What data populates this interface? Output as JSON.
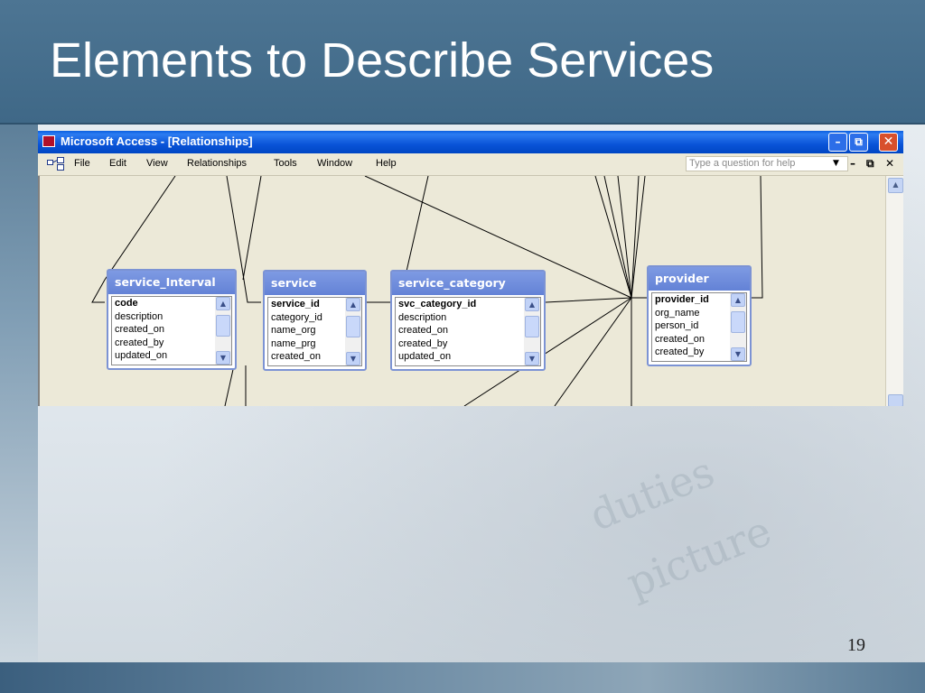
{
  "slide": {
    "title": "Elements to Describe Services",
    "page_number": "19"
  },
  "window": {
    "title": "Microsoft Access - [Relationships]",
    "minimize_glyph": "–",
    "restore_glyph": "⧉",
    "close_glyph": "✕"
  },
  "menu": {
    "items": [
      "File",
      "Edit",
      "View",
      "Relationships",
      "Tools",
      "Window",
      "Help"
    ],
    "ask_placeholder": "Type a question for help",
    "ask_dropdown_glyph": "▼",
    "mdi_minimize_glyph": "–",
    "mdi_restore_glyph": "⧉",
    "mdi_close_glyph": "✕"
  },
  "tables": [
    {
      "name": "service_Interval",
      "fields": [
        "code",
        "description",
        "created_on",
        "created_by",
        "updated_on"
      ],
      "primary_key": "code"
    },
    {
      "name": "service",
      "fields": [
        "service_id",
        "category_id",
        "name_org",
        "name_prg",
        "created_on"
      ],
      "primary_key": "service_id"
    },
    {
      "name": "service_category",
      "fields": [
        "svc_category_id",
        "description",
        "created_on",
        "created_by",
        "updated_on"
      ],
      "primary_key": "svc_category_id"
    },
    {
      "name": "provider",
      "fields": [
        "provider_id",
        "org_name",
        "person_id",
        "created_on",
        "created_by"
      ],
      "primary_key": "provider_id"
    }
  ],
  "colors": {
    "title_bar": "#46708f",
    "xp_caption": "#0a54d8",
    "table_header": "#6f8bdc",
    "dialog_face": "#ece9d8"
  },
  "icons": [
    "relationships-icon",
    "access-app-icon",
    "scroll-up-icon",
    "scroll-down-icon"
  ]
}
